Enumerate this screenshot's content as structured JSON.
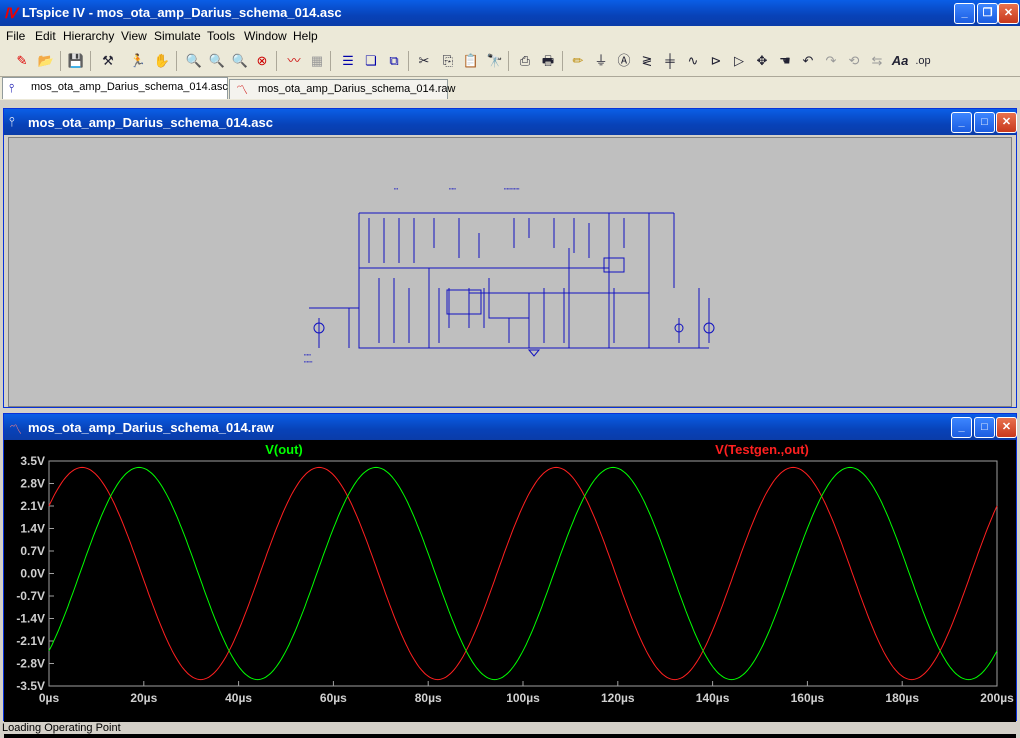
{
  "window": {
    "title": "LTspice IV - mos_ota_amp_Darius_schema_014.asc",
    "app_icon": "ltspice-icon"
  },
  "menu": [
    "File",
    "Edit",
    "Hierarchy",
    "View",
    "Simulate",
    "Tools",
    "Window",
    "Help"
  ],
  "toolbar": [
    "new-schematic-icon",
    "open-icon",
    "save-icon",
    "control-panel-icon",
    "run-icon",
    "halt-icon",
    "zoom-in-icon",
    "zoom-pan-icon",
    "zoom-out-icon",
    "zoom-fit-icon",
    "autorange-icon",
    "fft-icon",
    "tile-horizontal-icon",
    "cascade-icon",
    "close-windows-icon",
    "cut-icon",
    "copy-icon",
    "paste-icon",
    "find-icon",
    "print-setup-icon",
    "print-icon",
    "wire-icon",
    "ground-icon",
    "label-icon",
    "resistor-icon",
    "capacitor-icon",
    "inductor-icon",
    "diode-icon",
    "component-icon",
    "move-icon",
    "drag-icon",
    "undo-icon",
    "redo-icon",
    "rotate-icon",
    "mirror-icon",
    "text-icon",
    "spice-directive-icon"
  ],
  "tabs": [
    {
      "label": "mos_ota_amp_Darius_schema_014.asc",
      "icon": "schematic-icon"
    },
    {
      "label": "mos_ota_amp_Darius_schema_014.raw",
      "icon": "waveform-icon"
    }
  ],
  "schematic_window": {
    "title": "mos_ota_amp_Darius_schema_014.asc"
  },
  "plot_window": {
    "title": "mos_ota_amp_Darius_schema_014.raw"
  },
  "chart_data": {
    "type": "line",
    "x_range": [
      0,
      200
    ],
    "x_unit": "µs",
    "y_range": [
      -3.5,
      3.5
    ],
    "y_unit": "V",
    "y_ticks": [
      "3.5V",
      "2.8V",
      "2.1V",
      "1.4V",
      "0.7V",
      "0.0V",
      "-0.7V",
      "-1.4V",
      "-2.1V",
      "-2.8V",
      "-3.5V"
    ],
    "x_ticks": [
      "0µs",
      "20µs",
      "40µs",
      "60µs",
      "80µs",
      "100µs",
      "120µs",
      "140µs",
      "160µs",
      "180µs",
      "200µs"
    ],
    "grid": false,
    "series": [
      {
        "name": "V(out)",
        "color": "#00ff00",
        "amplitude": 3.3,
        "period_us": 50,
        "peak_at_us": [
          19,
          69,
          119,
          169
        ],
        "start_value": -2.1,
        "end_value": -2.2
      },
      {
        "name": "V(Testgen.,out)",
        "color": "#ff2020",
        "amplitude": 3.3,
        "period_us": 50,
        "peak_at_us": [
          7,
          57,
          107,
          157
        ],
        "start_value": 2.1,
        "end_value": 2.2
      }
    ]
  },
  "status": {
    "text": "Loading Operating Point"
  },
  "colors": {
    "title_blue": "#0842b8",
    "schematic_bg": "#bfbfbf",
    "wire_blue": "#1010c0",
    "plot_bg": "#000000"
  }
}
